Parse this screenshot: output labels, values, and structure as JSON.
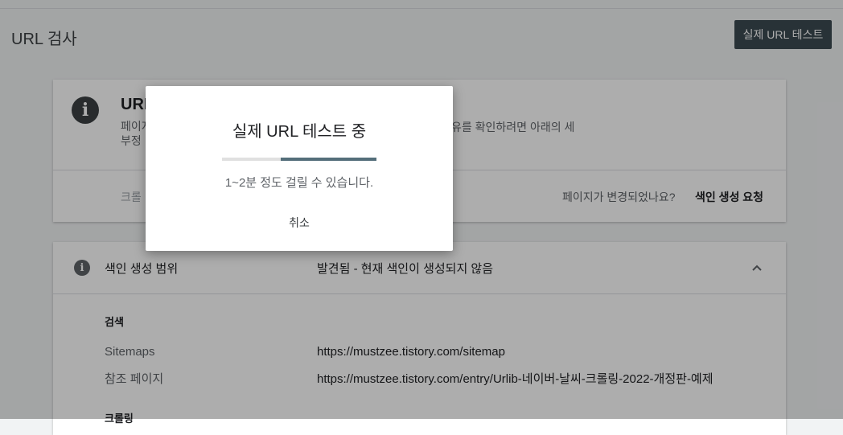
{
  "header": {
    "title": "URL 검사",
    "live_test_button": "실제 URL 테스트"
  },
  "url_card": {
    "title": "URL",
    "desc_line1": "페이지",
    "desc_line1_right": "유를 확인하려면 아래의 세",
    "desc_line2": "부정",
    "crawl_fragment": "크롤",
    "changed_question": "페이지가 변경되었나요?",
    "request_indexing": "색인 생성 요청"
  },
  "coverage": {
    "label": "색인 생성 범위",
    "status": "발견됨 - 현재 색인이 생성되지 않음",
    "discovery_heading": "검색",
    "rows": [
      {
        "label": "Sitemaps",
        "value": "https://mustzee.tistory.com/sitemap"
      },
      {
        "label": "참조 페이지",
        "value": "https://mustzee.tistory.com/entry/Urlib-네이버-날씨-크롤링-2022-개정판-예제"
      }
    ],
    "crawl_heading": "크롤링"
  },
  "dialog": {
    "title": "실제 URL 테스트 중",
    "message": "1~2분 정도 걸릴 수 있습니다.",
    "cancel": "취소",
    "progress_color": "#546e7a"
  },
  "icons": {
    "info": "info-icon",
    "chevron": "chevron-up-icon"
  }
}
